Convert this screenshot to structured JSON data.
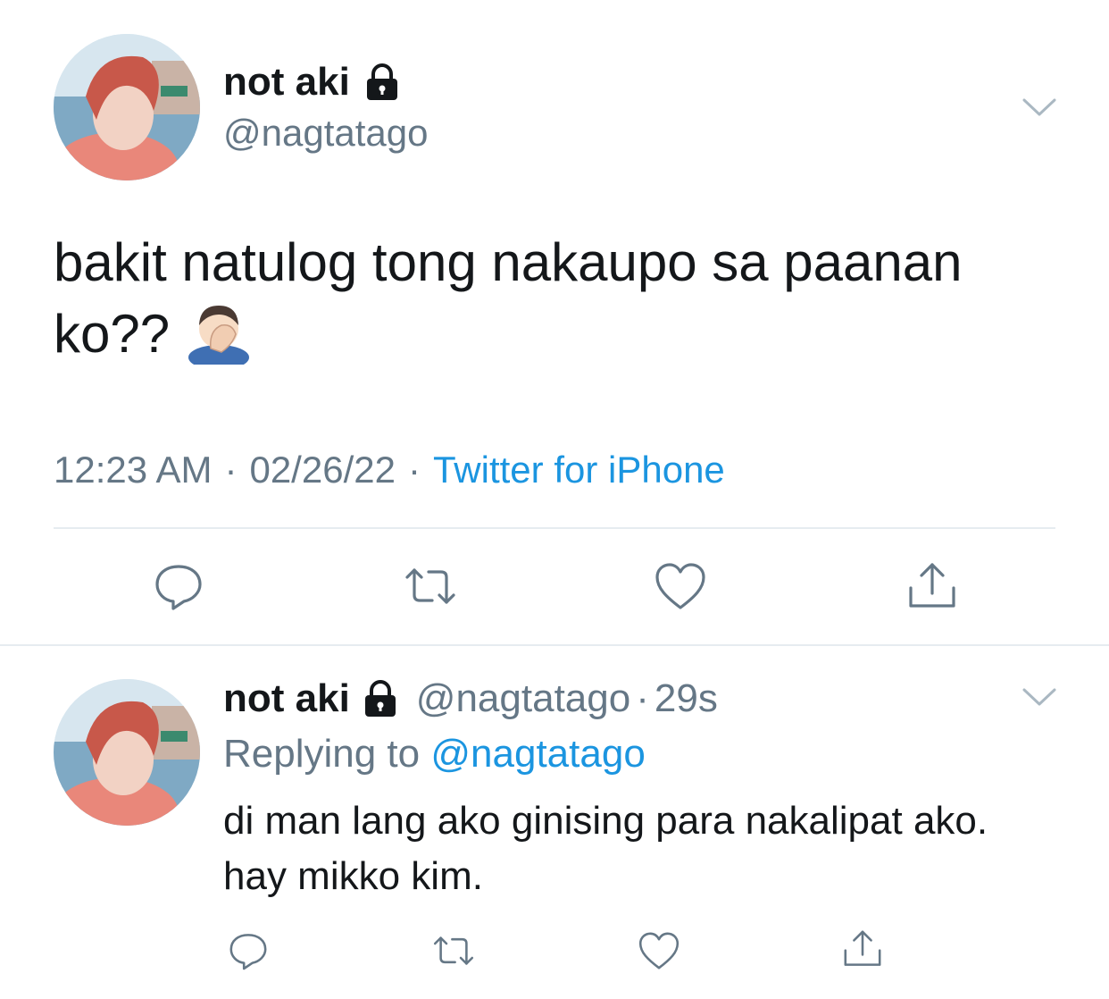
{
  "tweet": {
    "author": {
      "name": "not aki",
      "handle": "@nagtatago",
      "locked_icon": "lock-icon"
    },
    "text": "bakit natulog tong nakaupo sa paanan ko??",
    "emoji": "man-facepalming-emoji",
    "time": "12:23 AM",
    "date": "02/26/22",
    "separator": "·",
    "source": "Twitter for iPhone",
    "actions": [
      "reply-icon",
      "retweet-icon",
      "like-icon",
      "share-icon"
    ]
  },
  "reply": {
    "author": {
      "name": "not aki",
      "handle": "@nagtatago",
      "locked_icon": "lock-icon"
    },
    "separator": "·",
    "time": "29s",
    "replying_prefix": "Replying to",
    "replying_to": "@nagtatago",
    "text": "di man lang ako ginising para nakalipat ako. hay mikko kim.",
    "actions": [
      "reply-icon",
      "retweet-icon",
      "like-icon",
      "share-icon"
    ]
  },
  "colors": {
    "link": "#1b95e0",
    "secondary_text": "#657786",
    "divider": "#e6ecf0"
  }
}
